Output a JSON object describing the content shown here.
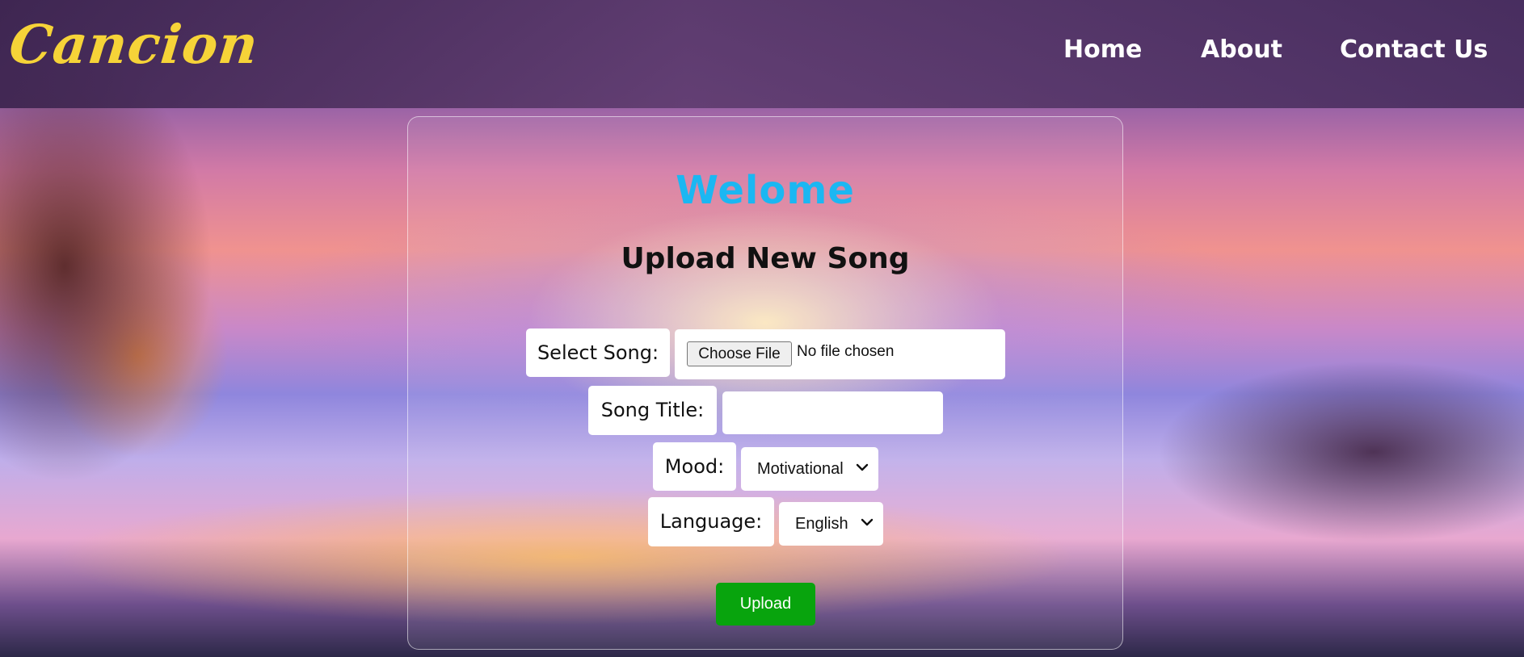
{
  "header": {
    "logo": "Cancion",
    "nav": {
      "home": "Home",
      "about": "About",
      "contact": "Contact Us"
    }
  },
  "main": {
    "welcome": "Welome",
    "heading": "Upload New Song",
    "form": {
      "song_label": "Select Song:",
      "file_button": "Choose File",
      "file_status": "No file chosen",
      "title_label": "Song Title:",
      "title_value": "",
      "mood_label": "Mood:",
      "mood_selected": "Motivational",
      "language_label": "Language:",
      "language_selected": "English",
      "upload_button": "Upload"
    }
  },
  "colors": {
    "logo": "#f6d338",
    "welcome": "#1bb7f2",
    "upload_button": "#08a40d"
  }
}
